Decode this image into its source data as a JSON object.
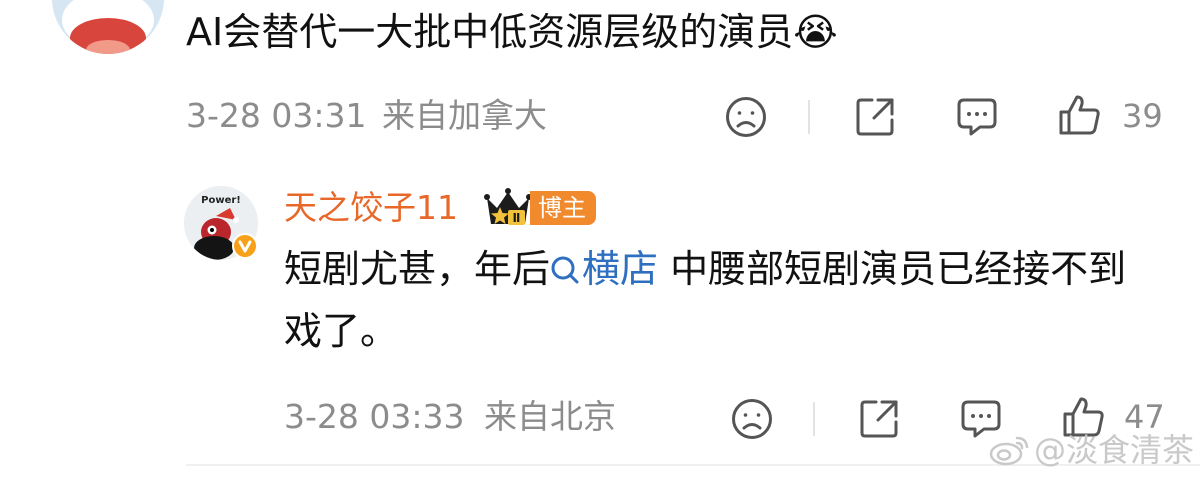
{
  "comment": {
    "text": "AI会替代一大批中低资源层级的演员😭",
    "time": "3-28 03:31",
    "location": "来自加拿大",
    "likes": "39"
  },
  "reply": {
    "username": "天之饺子11",
    "role_badge": "博主",
    "crown_level": "Ⅱ",
    "avatar_text": "Power!",
    "text_before": "短剧尤甚，年后",
    "topic": "横店",
    "text_after": " 中腰部短剧演员已经接不到戏了。",
    "time": "3-28 03:33",
    "location": "来自北京",
    "likes": "47"
  },
  "watermark": "@淡食清茶",
  "icons": {
    "dislike": "sad-face-icon",
    "share": "share-icon",
    "comment": "comment-bubble-icon",
    "like": "thumbs-up-icon",
    "verified": "verified-v-icon",
    "topic": "search-icon",
    "watermark": "weibo-logo-icon"
  },
  "colors": {
    "username": "#e8682a",
    "topic_link": "#2f6fbf",
    "badge": "#f08a2c",
    "meta": "#8c8c8c"
  }
}
